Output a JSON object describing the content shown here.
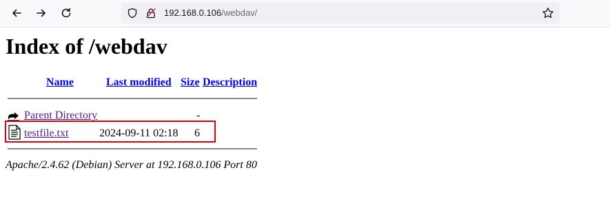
{
  "browser": {
    "url_host": "192.168.0.106",
    "url_path": "/webdav/",
    "icons": [
      "back-arrow-icon",
      "forward-arrow-icon",
      "reload-icon",
      "shield-icon",
      "insecure-lock-icon",
      "bookmark-star-icon"
    ]
  },
  "page": {
    "title": "Index of /webdav",
    "columns": {
      "name": "Name",
      "last_modified": "Last modified",
      "size": "Size",
      "description": "Description"
    },
    "rows": [
      {
        "name": "Parent Directory",
        "last_modified": "",
        "size": "-",
        "description": "",
        "icon": "back-folder-icon"
      },
      {
        "name": "testfile.txt",
        "last_modified": "2024-09-11 02:18",
        "size": "6",
        "description": "",
        "icon": "text-file-icon"
      }
    ],
    "footer": "Apache/2.4.62 (Debian) Server at 192.168.0.106 Port 80"
  },
  "highlight_color": "#e0000b",
  "link_color": "#0000ee",
  "visited_color": "#551a8b"
}
